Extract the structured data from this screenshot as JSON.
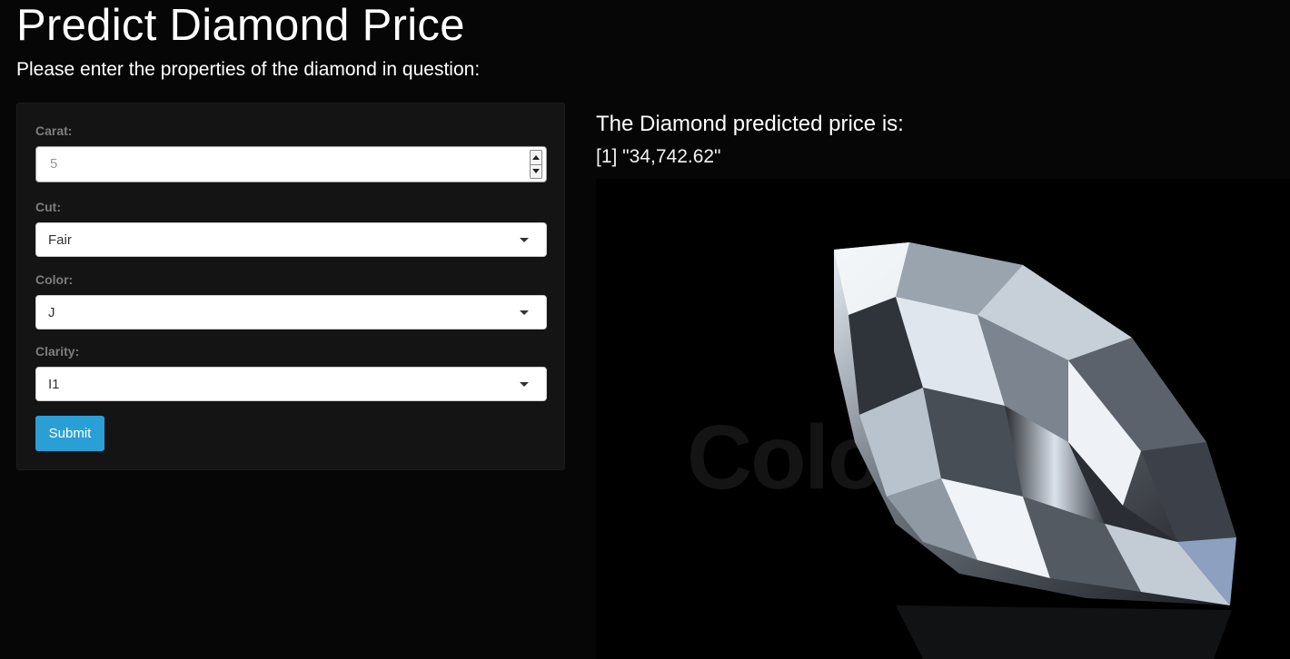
{
  "header": {
    "title": "Predict Diamond Price",
    "subtitle": "Please enter the properties of the diamond in question:"
  },
  "form": {
    "carat": {
      "label": "Carat:",
      "value": "5"
    },
    "cut": {
      "label": "Cut:",
      "selected": "Fair"
    },
    "color": {
      "label": "Color:",
      "selected": "J"
    },
    "clarity": {
      "label": "Clarity:",
      "selected": "I1"
    },
    "submit_label": "Submit"
  },
  "result": {
    "heading": "The Diamond predicted price is:",
    "value": "[1] \"34,742.62\""
  },
  "image": {
    "subject": "diamond",
    "watermark": "Colourbox"
  },
  "colors": {
    "background": "#060606",
    "panel": "#141414",
    "accent": "#2a9fd6",
    "label": "#7d7d7d"
  }
}
